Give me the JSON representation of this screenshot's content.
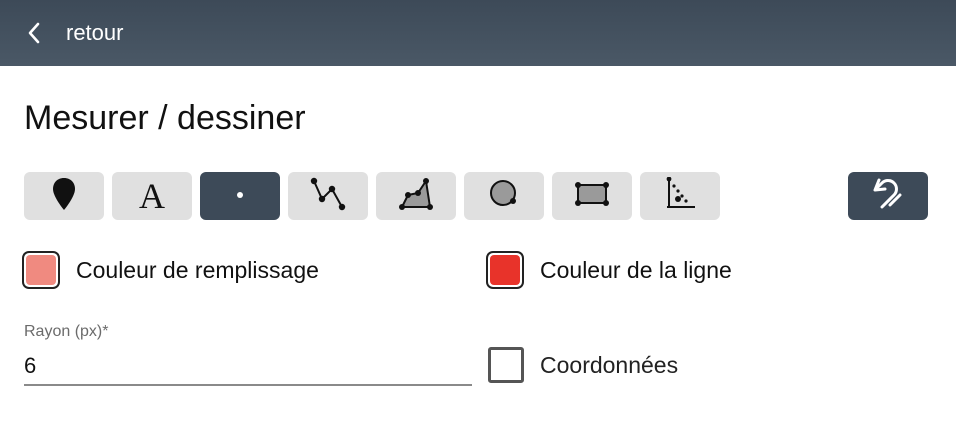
{
  "header": {
    "back_icon": "chevron-left-icon",
    "back_label": "retour"
  },
  "page": {
    "title": "Mesurer / dessiner"
  },
  "toolbar": {
    "tools": [
      {
        "name": "marker",
        "icon": "map-pin-icon",
        "active": false
      },
      {
        "name": "text",
        "icon": "text-A-icon",
        "label": "A",
        "active": false
      },
      {
        "name": "point",
        "icon": "point-icon",
        "active": true
      },
      {
        "name": "line",
        "icon": "polyline-icon",
        "active": false
      },
      {
        "name": "polygon",
        "icon": "polygon-icon",
        "active": false
      },
      {
        "name": "circle",
        "icon": "circle-icon",
        "active": false
      },
      {
        "name": "rectangle",
        "icon": "rectangle-icon",
        "active": false
      },
      {
        "name": "coordinates",
        "icon": "axes-icon",
        "active": false
      }
    ],
    "undo_icon": "undo-icon"
  },
  "fill_color": {
    "label": "Couleur de remplissage",
    "value": "#f08a80"
  },
  "line_color": {
    "label": "Couleur de la ligne",
    "value": "#e8332a"
  },
  "radius": {
    "label": "Rayon (px)*",
    "value": "6"
  },
  "coordinates": {
    "label": "Coordonnées",
    "checked": false
  },
  "colors": {
    "header_bg": "#3d4a58",
    "active_tool": "#3d4a58",
    "inactive_tool": "#e0e0e0"
  }
}
